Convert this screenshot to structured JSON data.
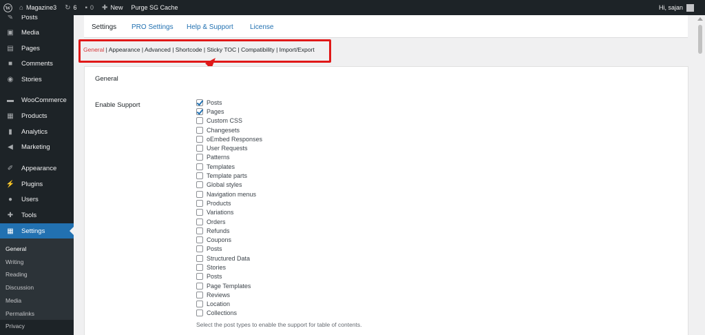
{
  "adminbar": {
    "site_name": "Magazine3",
    "updates_count": "6",
    "comments_count": "0",
    "new_label": "New",
    "purge_label": "Purge SG Cache",
    "greeting": "Hi, sajan"
  },
  "sidebar": {
    "items": [
      {
        "label": "Posts",
        "icon": "pin-icon",
        "glyph": "✎"
      },
      {
        "label": "Media",
        "icon": "media-icon",
        "glyph": "▣"
      },
      {
        "label": "Pages",
        "icon": "pages-icon",
        "glyph": "▤"
      },
      {
        "label": "Comments",
        "icon": "comment-icon",
        "glyph": "■"
      },
      {
        "label": "Stories",
        "icon": "stories-icon",
        "glyph": "◉"
      },
      {
        "label": "WooCommerce",
        "icon": "woo-icon",
        "glyph": "▬"
      },
      {
        "label": "Products",
        "icon": "products-icon",
        "glyph": "▦"
      },
      {
        "label": "Analytics",
        "icon": "analytics-icon",
        "glyph": "▮"
      },
      {
        "label": "Marketing",
        "icon": "megaphone-icon",
        "glyph": "◀"
      },
      {
        "label": "Appearance",
        "icon": "brush-icon",
        "glyph": "✐"
      },
      {
        "label": "Plugins",
        "icon": "plugin-icon",
        "glyph": "⚡"
      },
      {
        "label": "Users",
        "icon": "user-icon",
        "glyph": "●"
      },
      {
        "label": "Tools",
        "icon": "wrench-icon",
        "glyph": "✚"
      },
      {
        "label": "Settings",
        "icon": "settings-icon",
        "glyph": "▦"
      }
    ],
    "submenu": [
      "General",
      "Writing",
      "Reading",
      "Discussion",
      "Media",
      "Permalinks",
      "Privacy"
    ]
  },
  "tabs": [
    "Settings",
    "PRO Settings",
    "Help & Support",
    "License"
  ],
  "subnav": {
    "current": "General",
    "links": [
      "Appearance",
      "Advanced",
      "Shortcode",
      "Sticky TOC",
      "Compatibility",
      "Import/Export"
    ],
    "separator": " | "
  },
  "panel": {
    "section_title": "General",
    "field_label": "Enable Support",
    "options": [
      {
        "label": "Posts",
        "checked": true
      },
      {
        "label": "Pages",
        "checked": true
      },
      {
        "label": "Custom CSS",
        "checked": false
      },
      {
        "label": "Changesets",
        "checked": false
      },
      {
        "label": "oEmbed Responses",
        "checked": false
      },
      {
        "label": "User Requests",
        "checked": false
      },
      {
        "label": "Patterns",
        "checked": false
      },
      {
        "label": "Templates",
        "checked": false
      },
      {
        "label": "Template parts",
        "checked": false
      },
      {
        "label": "Global styles",
        "checked": false
      },
      {
        "label": "Navigation menus",
        "checked": false
      },
      {
        "label": "Products",
        "checked": false
      },
      {
        "label": "Variations",
        "checked": false
      },
      {
        "label": "Orders",
        "checked": false
      },
      {
        "label": "Refunds",
        "checked": false
      },
      {
        "label": "Coupons",
        "checked": false
      },
      {
        "label": "Posts",
        "checked": false
      },
      {
        "label": "Structured Data",
        "checked": false
      },
      {
        "label": "Stories",
        "checked": false
      },
      {
        "label": "Posts",
        "checked": false
      },
      {
        "label": "Page Templates",
        "checked": false
      },
      {
        "label": "Reviews",
        "checked": false
      },
      {
        "label": "Location",
        "checked": false
      },
      {
        "label": "Collections",
        "checked": false
      }
    ],
    "help_text": "Select the post types to enable the support for table of contents."
  },
  "colors": {
    "accent": "#2271b1",
    "sidebar_bg": "#1d2327",
    "highlight": "#e01818",
    "current_link": "#d63638"
  }
}
